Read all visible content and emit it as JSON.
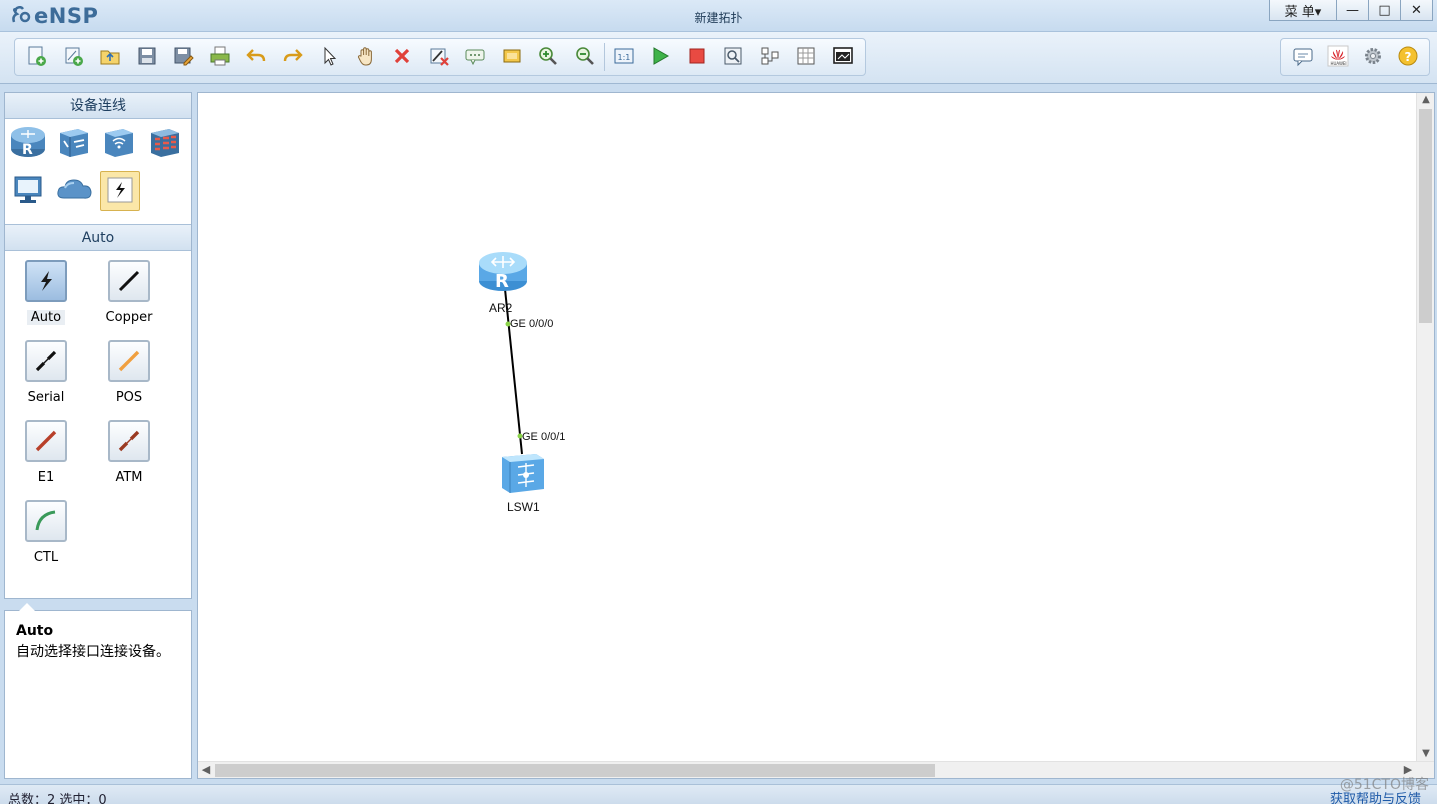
{
  "app": {
    "logo_text": "eNSP",
    "window_title": "新建拓扑",
    "menu_label": "菜 单▾"
  },
  "window_controls": {
    "minimize": "—",
    "maximize": "□",
    "close": "✕"
  },
  "toolbar": {
    "left_icons": [
      "new-topology-icon",
      "new-example-icon",
      "open-icon",
      "save-icon",
      "save-as-icon",
      "print-icon",
      "undo-icon",
      "redo-icon",
      "select-icon",
      "hand-icon",
      "delete-icon",
      "delete-all-links-icon",
      "add-text-icon",
      "palette-icon",
      "zoom-in-icon",
      "zoom-out-icon",
      "fit-view-icon",
      "start-device-icon",
      "stop-device-icon",
      "capture-icon",
      "topology-icon",
      "grid-icon",
      "terminal-icon"
    ],
    "right_icons": [
      "message-icon",
      "huawei-icon",
      "settings-icon",
      "help-icon"
    ]
  },
  "left_panel": {
    "section_title": "设备连线",
    "devices": [
      "router-icon",
      "switch-icon",
      "wlan-icon",
      "firewall-icon",
      "pc-icon",
      "cloud-icon",
      "link-icon"
    ],
    "cable_section_title": "Auto",
    "cables": [
      {
        "label": "Auto",
        "color": "#1a1a1a"
      },
      {
        "label": "Copper",
        "color": "#111111"
      },
      {
        "label": "Serial",
        "color": "#111111"
      },
      {
        "label": "POS",
        "color": "#f0a040"
      },
      {
        "label": "E1",
        "color": "#b8402a"
      },
      {
        "label": "ATM",
        "color": "#9a3a22"
      },
      {
        "label": "CTL",
        "color": "#3a9a5a"
      }
    ]
  },
  "info": {
    "title": "Auto",
    "description": "自动选择接口连接设备。"
  },
  "topology": {
    "nodes": [
      {
        "name": "AR2",
        "type": "router"
      },
      {
        "name": "LSW1",
        "type": "switch"
      }
    ],
    "link": {
      "from_port": "GE 0/0/0",
      "to_port": "GE 0/0/1"
    }
  },
  "status": {
    "left": "总数：2  选中：0",
    "right": "获取帮助与反馈"
  },
  "watermark": "@51CTO博客"
}
